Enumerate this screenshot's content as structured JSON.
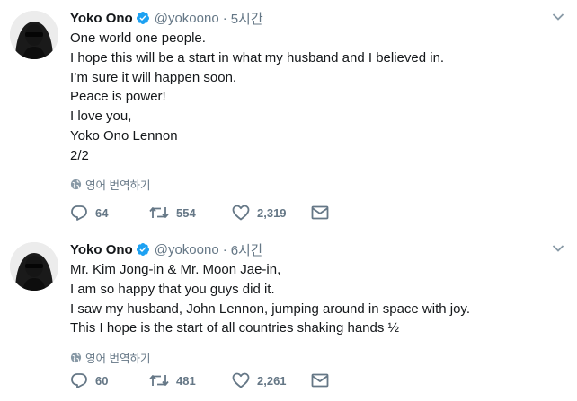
{
  "tweets": [
    {
      "author_name": "Yoko Ono",
      "handle": "@yokoono",
      "separator": "·",
      "time": "5시간",
      "lines": [
        "One world one people.",
        "I hope this will be a start in what my husband and I believed in.",
        "I’m sure it will happen soon.",
        "Peace is power!",
        "I love you,",
        "Yoko Ono Lennon",
        "2/2"
      ],
      "translate_label": "영어 번역하기",
      "replies": "64",
      "retweets": "554",
      "likes": "2,319"
    },
    {
      "author_name": "Yoko Ono",
      "handle": "@yokoono",
      "separator": "·",
      "time": "6시간",
      "lines": [
        "Mr. Kim Jong-in & Mr. Moon Jae-in,",
        "I am so happy that you guys did it.",
        "I saw my husband, John Lennon, jumping around in space with joy.",
        "This I hope is the start of all countries shaking hands ½"
      ],
      "translate_label": "영어 번역하기",
      "replies": "60",
      "retweets": "481",
      "likes": "2,261"
    }
  ],
  "colors": {
    "text": "#14171a",
    "muted": "#657786",
    "verified": "#1da1f2",
    "divider": "#e6ecf0"
  },
  "icons": [
    "verified-badge-icon",
    "chevron-down-icon",
    "globe-icon",
    "reply-icon",
    "retweet-icon",
    "like-icon",
    "direct-message-icon"
  ]
}
